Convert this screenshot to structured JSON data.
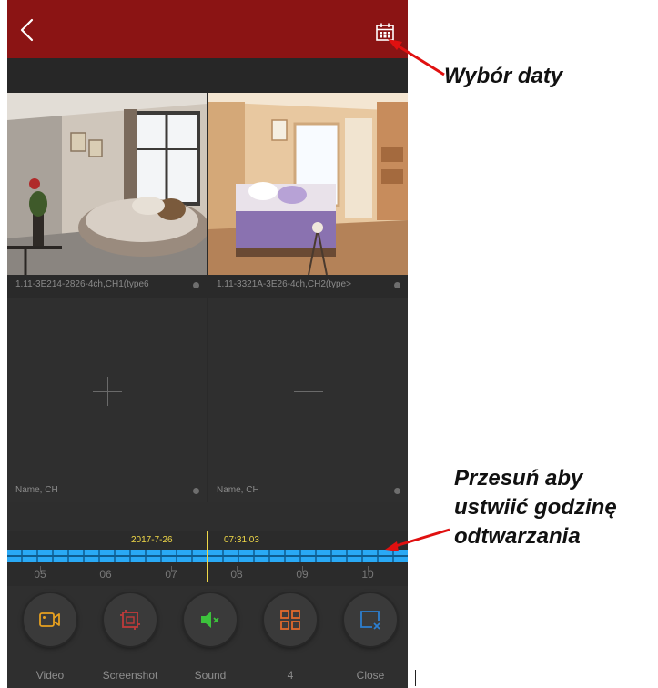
{
  "header": {
    "back_icon": "chevron-left-icon",
    "calendar_icon": "calendar-icon"
  },
  "cells": [
    {
      "caption": "1.11-3E214-2826-4ch,CH1(type6",
      "selected": true,
      "has_video": true
    },
    {
      "caption": "1.11-3321A-3E26-4ch,CH2(type>",
      "selected": false,
      "has_video": true
    },
    {
      "caption": "Name, CH",
      "selected": false,
      "has_video": false
    },
    {
      "caption": "Name, CH",
      "selected": false,
      "has_video": false
    }
  ],
  "timeline": {
    "date": "2017-7-26",
    "time": "07:31:03",
    "hours": [
      "05",
      "06",
      "07",
      "08",
      "09",
      "10"
    ],
    "colors": {
      "track": "#29a9f5",
      "cursor": "#f0d848"
    }
  },
  "controls": [
    {
      "label": "Video",
      "icon": "video-camera-icon",
      "color": "#e6a020"
    },
    {
      "label": "Screenshot",
      "icon": "screenshot-icon",
      "color": "#c03a3a"
    },
    {
      "label": "Sound",
      "icon": "speaker-muted-icon",
      "color": "#3cc23c"
    },
    {
      "label": "4",
      "icon": "grid-four-icon",
      "color": "#e06a2c"
    },
    {
      "label": "Close",
      "icon": "close-window-icon",
      "color": "#2d7fd0"
    }
  ],
  "annotations": {
    "date_selection": "Wybór daty",
    "slide_line1": "Przesuń aby",
    "slide_line2": "ustwiić godzinę",
    "slide_line3": "odtwarzania"
  },
  "colors": {
    "header": "#8b1414",
    "annotation_arrow": "#e01010"
  }
}
